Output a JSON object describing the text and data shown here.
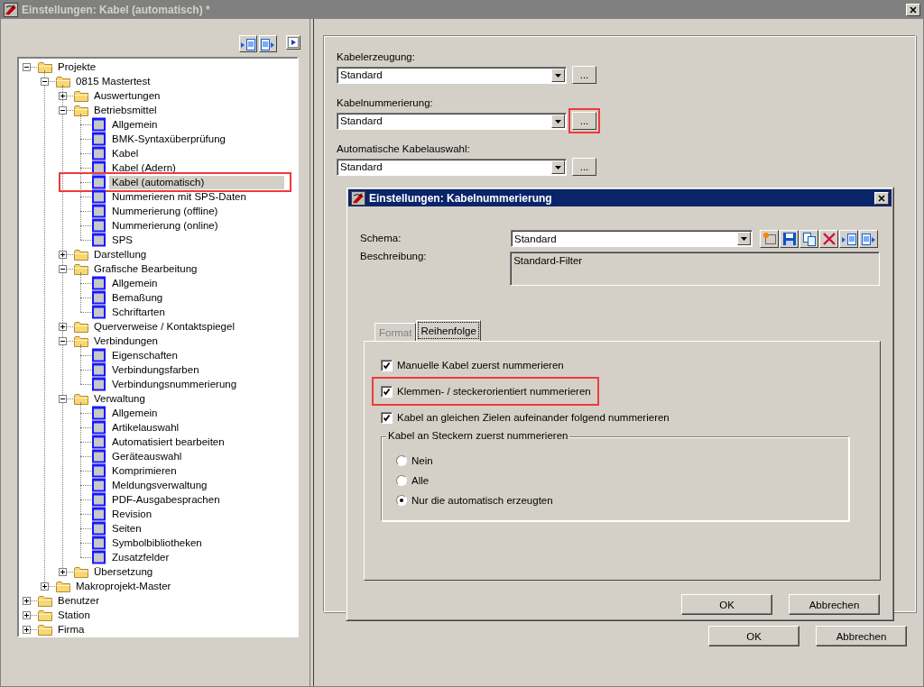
{
  "window": {
    "title": "Einstellungen: Kabel (automatisch) *",
    "buttons": [
      {
        "label": "OK"
      },
      {
        "label": "Abbrechen"
      }
    ]
  },
  "tree": [
    {
      "label": "Projekte",
      "kind": "folder",
      "expanded": true,
      "selected": false,
      "highlighted": false,
      "children": [
        {
          "label": "0815 Mastertest",
          "kind": "folder",
          "expanded": true,
          "selected": false,
          "highlighted": false,
          "children": [
            {
              "label": "Auswertungen",
              "kind": "folder",
              "expanded": false,
              "selected": false,
              "highlighted": false
            },
            {
              "label": "Betriebsmittel",
              "kind": "folder",
              "expanded": true,
              "selected": false,
              "highlighted": false,
              "children": [
                {
                  "label": "Allgemein",
                  "kind": "page",
                  "selected": false,
                  "highlighted": false
                },
                {
                  "label": "BMK-Syntaxüberprüfung",
                  "kind": "page",
                  "selected": false,
                  "highlighted": false
                },
                {
                  "label": "Kabel",
                  "kind": "page",
                  "selected": false,
                  "highlighted": false
                },
                {
                  "label": "Kabel (Adern)",
                  "kind": "page",
                  "selected": false,
                  "highlighted": false
                },
                {
                  "label": "Kabel (automatisch)",
                  "kind": "page",
                  "selected": true,
                  "highlighted": true
                },
                {
                  "label": "Nummerieren mit SPS-Daten",
                  "kind": "page",
                  "selected": false,
                  "highlighted": false
                },
                {
                  "label": "Nummerierung (offline)",
                  "kind": "page",
                  "selected": false,
                  "highlighted": false
                },
                {
                  "label": "Nummerierung (online)",
                  "kind": "page",
                  "selected": false,
                  "highlighted": false
                },
                {
                  "label": "SPS",
                  "kind": "page",
                  "selected": false,
                  "highlighted": false
                }
              ]
            },
            {
              "label": "Darstellung",
              "kind": "folder",
              "expanded": false,
              "selected": false,
              "highlighted": false
            },
            {
              "label": "Grafische Bearbeitung",
              "kind": "folder",
              "expanded": true,
              "selected": false,
              "highlighted": false,
              "children": [
                {
                  "label": "Allgemein",
                  "kind": "page",
                  "selected": false,
                  "highlighted": false
                },
                {
                  "label": "Bemaßung",
                  "kind": "page",
                  "selected": false,
                  "highlighted": false
                },
                {
                  "label": "Schriftarten",
                  "kind": "page",
                  "selected": false,
                  "highlighted": false
                }
              ]
            },
            {
              "label": "Querverweise / Kontaktspiegel",
              "kind": "folder",
              "expanded": false,
              "selected": false,
              "highlighted": false
            },
            {
              "label": "Verbindungen",
              "kind": "folder",
              "expanded": true,
              "selected": false,
              "highlighted": false,
              "children": [
                {
                  "label": "Eigenschaften",
                  "kind": "page",
                  "selected": false,
                  "highlighted": false
                },
                {
                  "label": "Verbindungsfarben",
                  "kind": "page",
                  "selected": false,
                  "highlighted": false
                },
                {
                  "label": "Verbindungsnummerierung",
                  "kind": "page",
                  "selected": false,
                  "highlighted": false
                }
              ]
            },
            {
              "label": "Verwaltung",
              "kind": "folder",
              "expanded": true,
              "selected": false,
              "highlighted": false,
              "children": [
                {
                  "label": "Allgemein",
                  "kind": "page",
                  "selected": false,
                  "highlighted": false
                },
                {
                  "label": "Artikelauswahl",
                  "kind": "page",
                  "selected": false,
                  "highlighted": false
                },
                {
                  "label": "Automatisiert bearbeiten",
                  "kind": "page",
                  "selected": false,
                  "highlighted": false
                },
                {
                  "label": "Geräteauswahl",
                  "kind": "page",
                  "selected": false,
                  "highlighted": false
                },
                {
                  "label": "Komprimieren",
                  "kind": "page",
                  "selected": false,
                  "highlighted": false
                },
                {
                  "label": "Meldungsverwaltung",
                  "kind": "page",
                  "selected": false,
                  "highlighted": false
                },
                {
                  "label": "PDF-Ausgabesprachen",
                  "kind": "page",
                  "selected": false,
                  "highlighted": false
                },
                {
                  "label": "Revision",
                  "kind": "page",
                  "selected": false,
                  "highlighted": false
                },
                {
                  "label": "Seiten",
                  "kind": "page",
                  "selected": false,
                  "highlighted": false
                },
                {
                  "label": "Symbolbibliotheken",
                  "kind": "page",
                  "selected": false,
                  "highlighted": false
                },
                {
                  "label": "Zusatzfelder",
                  "kind": "page",
                  "selected": false,
                  "highlighted": false
                }
              ]
            },
            {
              "label": "Übersetzung",
              "kind": "folder",
              "expanded": false,
              "selected": false,
              "highlighted": false
            }
          ]
        },
        {
          "label": "Makroprojekt-Master",
          "kind": "folder",
          "expanded": false,
          "selected": false,
          "highlighted": false
        }
      ]
    },
    {
      "label": "Benutzer",
      "kind": "folder",
      "expanded": false,
      "selected": false,
      "highlighted": false
    },
    {
      "label": "Station",
      "kind": "folder",
      "expanded": false,
      "selected": false,
      "highlighted": false
    },
    {
      "label": "Firma",
      "kind": "folder",
      "expanded": false,
      "selected": false,
      "highlighted": false
    }
  ],
  "settings": {
    "fields": [
      {
        "label": "Kabelerzeugung:",
        "value": "Standard",
        "button": "...",
        "highlighted": false
      },
      {
        "label": "Kabelnummerierung:",
        "value": "Standard",
        "button": "...",
        "highlighted": true
      },
      {
        "label": "Automatische Kabelauswahl:",
        "value": "Standard",
        "button": "...",
        "highlighted": false
      }
    ]
  },
  "dialog": {
    "title": "Einstellungen: Kabelnummerierung",
    "schema": {
      "label": "Schema:",
      "value": "Standard"
    },
    "description": {
      "label": "Beschreibung:",
      "value": "Standard-Filter"
    },
    "tabs": [
      {
        "label": "Format",
        "selected": false
      },
      {
        "label": "Reihenfolge",
        "selected": true
      }
    ],
    "checkboxes": [
      {
        "label": "Manuelle Kabel zuerst nummerieren",
        "checked": true,
        "highlighted": false
      },
      {
        "label": "Klemmen- / steckerorientiert nummerieren",
        "checked": true,
        "highlighted": true
      },
      {
        "label": "Kabel an gleichen Zielen aufeinander folgend nummerieren",
        "checked": true,
        "highlighted": false
      }
    ],
    "group": {
      "title": "Kabel an Steckern zuerst nummerieren",
      "options": [
        {
          "label": "Nein",
          "selected": false
        },
        {
          "label": "Alle",
          "selected": false
        },
        {
          "label": "Nur die automatisch erzeugten",
          "selected": true
        }
      ]
    },
    "buttons": [
      {
        "label": "OK"
      },
      {
        "label": "Abbrechen"
      }
    ]
  }
}
